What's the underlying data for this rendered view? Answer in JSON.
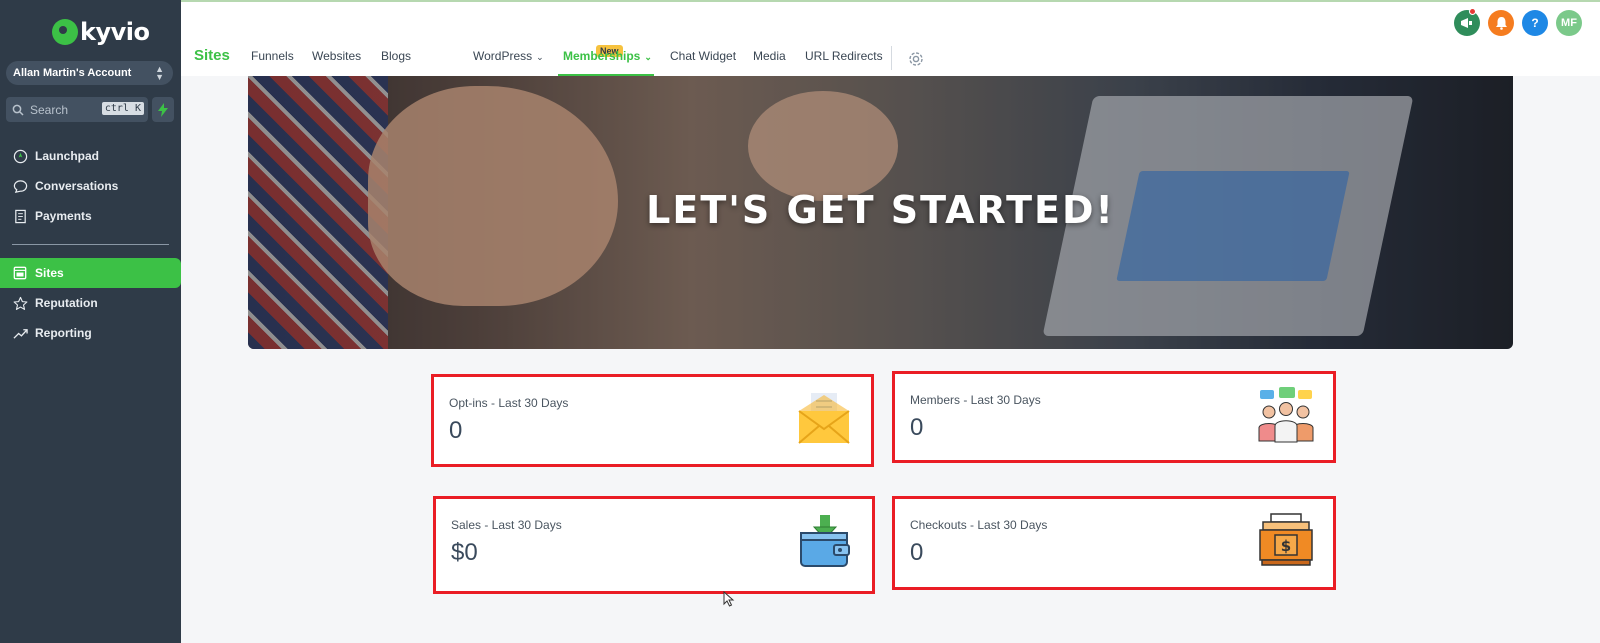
{
  "sidebar": {
    "logo": "kyvio",
    "account": "Allan Martin's Account",
    "search_placeholder": "Search",
    "search_shortcut": "ctrl K",
    "nav_top": [
      {
        "label": "Launchpad",
        "icon": "rocket-icon"
      },
      {
        "label": "Conversations",
        "icon": "chat-bubble-icon"
      },
      {
        "label": "Payments",
        "icon": "receipt-icon"
      }
    ],
    "nav_bottom": [
      {
        "label": "Sites",
        "icon": "site-icon",
        "active": true
      },
      {
        "label": "Reputation",
        "icon": "star-icon"
      },
      {
        "label": "Reporting",
        "icon": "trend-icon"
      }
    ]
  },
  "topbar": {
    "title": "Sites",
    "tabs": [
      "Funnels",
      "Websites",
      "Blogs",
      "WordPress",
      "Memberships",
      "Chat Widget",
      "Media",
      "URL Redirects"
    ],
    "active_tab": "Memberships",
    "new_badge": "New",
    "avatar_initials": "MF"
  },
  "banner": {
    "title": "LET'S GET STARTED!"
  },
  "stats": [
    {
      "label": "Opt-ins - Last 30 Days",
      "value": "0",
      "icon": "envelope-icon"
    },
    {
      "label": "Members - Last 30 Days",
      "value": "0",
      "icon": "people-chat-icon"
    },
    {
      "label": "Sales - Last 30 Days",
      "value": "$0",
      "icon": "wallet-icon"
    },
    {
      "label": "Checkouts - Last 30 Days",
      "value": "0",
      "icon": "cash-register-icon"
    }
  ],
  "colors": {
    "sidebar_bg": "#2f3b48",
    "accent_green": "#3cc146",
    "highlight_red": "#ea1d25"
  }
}
